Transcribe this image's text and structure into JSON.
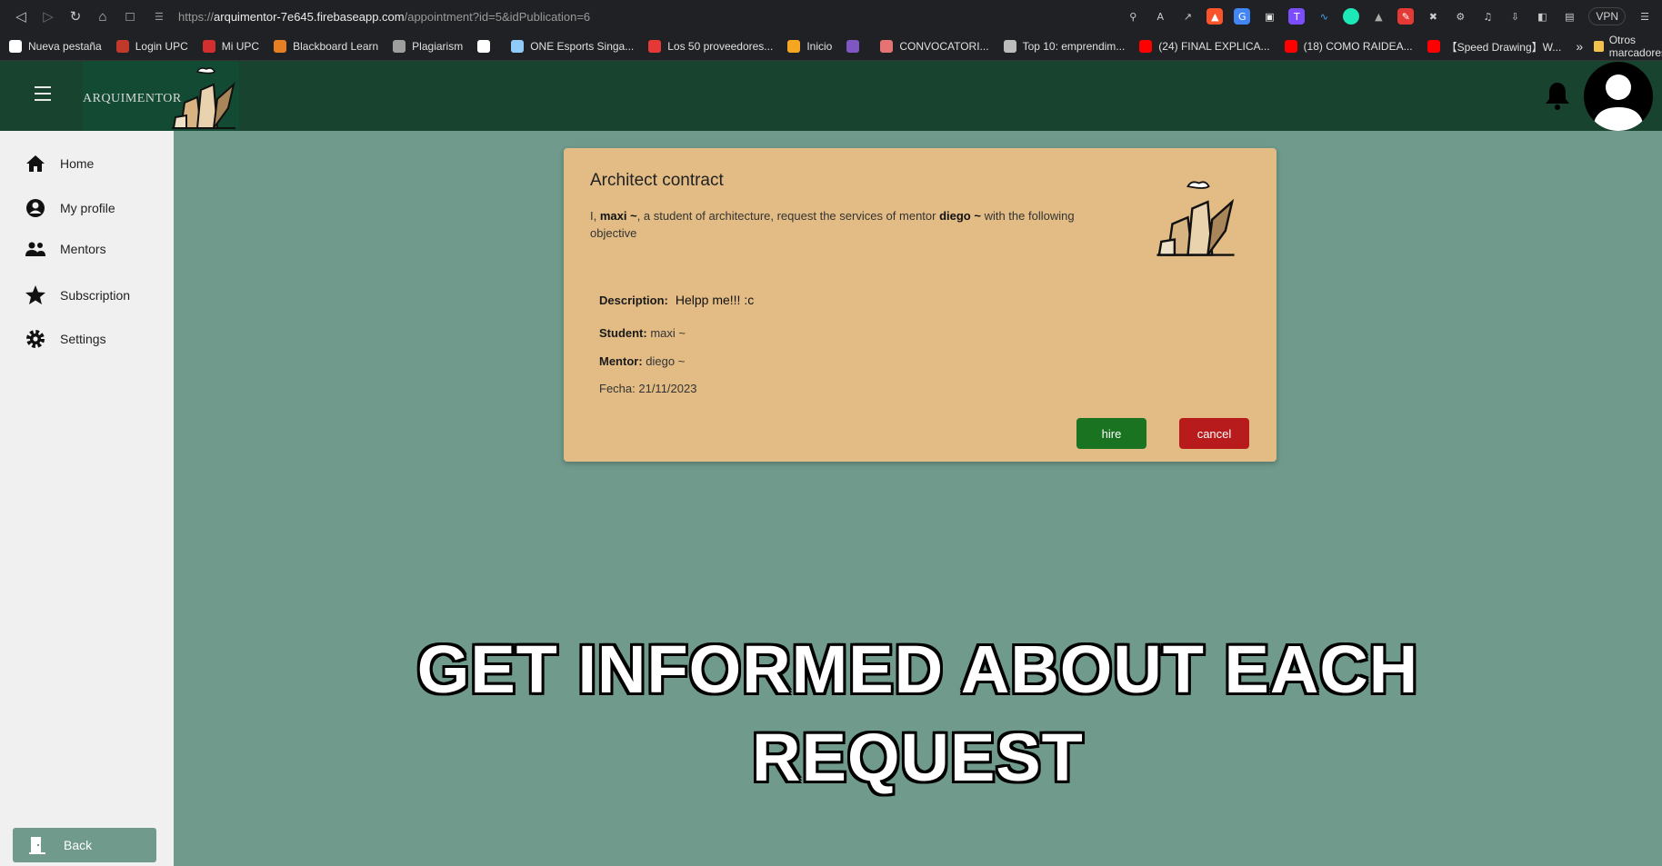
{
  "browser": {
    "url_protocol": "https://",
    "url_host": "arquimentor-7e645.firebaseapp.com",
    "url_path": "/appointment?id=5&idPublication=6",
    "vpn_label": "VPN",
    "bookmarks": [
      {
        "label": "Nueva pestaña",
        "color": "#ffffff"
      },
      {
        "label": "Login UPC",
        "color": "#c0392b"
      },
      {
        "label": "Mi UPC",
        "color": "#d32f2f"
      },
      {
        "label": "Blackboard Learn",
        "color": "#e67e22"
      },
      {
        "label": "Plagiarism",
        "color": "#9e9e9e"
      },
      {
        "label": "",
        "color": "#ffffff"
      },
      {
        "label": "ONE Esports Singa...",
        "color": "#90caf9"
      },
      {
        "label": "Los 50 proveedores...",
        "color": "#e53935"
      },
      {
        "label": "Inicio",
        "color": "#f5a623"
      },
      {
        "label": "",
        "color": "#7e57c2"
      },
      {
        "label": "CONVOCATORI...",
        "color": "#e57373"
      },
      {
        "label": "Top 10: emprendim...",
        "color": "#bdbdbd"
      },
      {
        "label": "(24) FINAL EXPLICA...",
        "color": "#ff0000"
      },
      {
        "label": "(18) COMO RAIDEA...",
        "color": "#ff0000"
      },
      {
        "label": "【Speed Drawing】W...",
        "color": "#ff0000"
      }
    ],
    "more_label": "»",
    "other_bookmarks": "Otros marcadores"
  },
  "header": {
    "logo_text": "ARQUIMENTOR"
  },
  "sidebar": {
    "items": [
      {
        "label": "Home",
        "icon": "home-icon"
      },
      {
        "label": "My profile",
        "icon": "account-circle-icon"
      },
      {
        "label": "Mentors",
        "icon": "people-icon"
      },
      {
        "label": "Subscription",
        "icon": "star-icon"
      },
      {
        "label": "Settings",
        "icon": "gear-icon"
      }
    ],
    "back_label": "Back"
  },
  "dialog": {
    "title": "Architect contract",
    "intro_prefix": "I, ",
    "intro_student": "maxi ~",
    "intro_middle": ", a student of architecture, request the services of mentor ",
    "intro_mentor": "diego ~",
    "intro_suffix": " with the following objective",
    "description_key": "Description:",
    "description_value": "Helpp me!!! :c",
    "student_key": "Student:",
    "student_value": "maxi ~",
    "mentor_key": "Mentor:",
    "mentor_value": "diego ~",
    "date_line": "Fecha: 21/11/2023",
    "hire_label": "hire",
    "cancel_label": "cancel"
  },
  "caption": {
    "line1": "GET INFORMED ABOUT EACH",
    "line2": "REQUEST"
  },
  "colors": {
    "header": "#17432f",
    "content_bg": "#6f9a8c",
    "dialog_bg": "#e2bc84",
    "hire": "#1a7320",
    "cancel": "#b71b1b"
  }
}
